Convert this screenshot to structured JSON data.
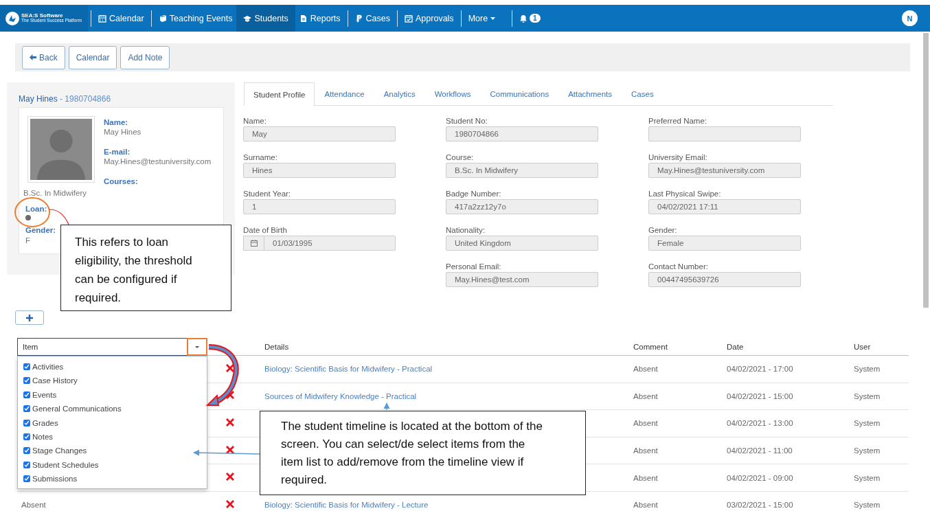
{
  "nav": {
    "logo": {
      "title": "SEA:S Software",
      "subtitle": "The Student Success Platform"
    },
    "items": [
      {
        "label": "Calendar",
        "kind": "link",
        "selected": false
      },
      {
        "label": "Teaching Events",
        "kind": "link",
        "selected": false
      },
      {
        "label": "Students",
        "kind": "link",
        "selected": true
      },
      {
        "label": "Reports",
        "kind": "link",
        "selected": false
      },
      {
        "label": "Cases",
        "kind": "link",
        "selected": false
      },
      {
        "label": "Approvals",
        "kind": "link",
        "selected": false
      },
      {
        "label": "More",
        "kind": "menu",
        "selected": false
      }
    ],
    "notifications": "1",
    "avatar": "N"
  },
  "toolbar": {
    "buttons": [
      {
        "label": "Back"
      },
      {
        "label": "Calendar"
      },
      {
        "label": "Add Note"
      }
    ]
  },
  "profile": {
    "name": "May Hines",
    "number": "- 1980704866",
    "fields": [
      {
        "label": "Name:",
        "value": "May Hines"
      },
      {
        "label": "E-mail:",
        "value": "May.Hines@testuniversity.com"
      },
      {
        "label": "Courses:"
      }
    ],
    "course": "B.Sc. In Midwifery",
    "loan": {
      "label": "Loan:",
      "color": "#6b6b6b"
    },
    "gender": {
      "label": "Gender:",
      "value": "F"
    }
  },
  "tabs": [
    {
      "label": "Student Profile",
      "selected": true
    },
    {
      "label": "Attendance",
      "selected": false
    },
    {
      "label": "Analytics",
      "selected": false
    },
    {
      "label": "Workflows",
      "selected": false
    },
    {
      "label": "Communications",
      "selected": false
    },
    {
      "label": "Attachments",
      "selected": false
    },
    {
      "label": "Cases",
      "selected": false
    }
  ],
  "form": {
    "columns": [
      [
        {
          "label": "Name:",
          "value": "May",
          "kind": "text"
        },
        {
          "label": "Surname:",
          "value": "Hines",
          "kind": "text"
        },
        {
          "label": "Student Year:",
          "value": "1",
          "kind": "text"
        },
        {
          "label": "Date of Birth",
          "value": "01/03/1995",
          "kind": "date"
        }
      ],
      [
        {
          "label": "Student No:",
          "value": "1980704866",
          "kind": "text"
        },
        {
          "label": "Course:",
          "value": "B.Sc. In Midwifery",
          "kind": "text"
        },
        {
          "label": "Badge Number:",
          "value": "417a2zz12y7o",
          "kind": "text"
        },
        {
          "label": "Nationality:",
          "value": "United Kingdom",
          "kind": "text"
        },
        {
          "label": "Personal Email:",
          "value": "May.Hines@test.com",
          "kind": "text"
        }
      ],
      [
        {
          "label": "Preferred Name:",
          "kind": "text"
        },
        {
          "label": "University Email:",
          "value": "May.Hines@testuniversity.com",
          "kind": "text"
        },
        {
          "label": "Last Physical Swipe:",
          "value": "04/02/2021 17:11",
          "kind": "text"
        },
        {
          "label": "Gender:",
          "value": "Female",
          "kind": "text"
        },
        {
          "label": "Contact Number:",
          "value": "00447495639726",
          "kind": "text"
        }
      ]
    ]
  },
  "timeline": {
    "filter": {
      "label": "Item",
      "options": [
        {
          "label": "Activities",
          "checked": true
        },
        {
          "label": "Case History",
          "checked": true
        },
        {
          "label": "Events",
          "checked": true
        },
        {
          "label": "General Communications",
          "checked": true
        },
        {
          "label": "Grades",
          "checked": true
        },
        {
          "label": "Notes",
          "checked": true
        },
        {
          "label": "Stage Changes",
          "checked": true
        },
        {
          "label": "Student Schedules",
          "checked": true
        },
        {
          "label": "Submissions",
          "checked": true
        }
      ]
    },
    "columns": [
      "Details",
      "Comment",
      "Date",
      "User"
    ],
    "rows": [
      {
        "details": "Biology: Scientific Basis for Midwifery - Practical",
        "comment": "Absent",
        "date": "04/02/2021 - 17:00",
        "user": "System"
      },
      {
        "details": "Sources of Midwifery Knowledge - Practical",
        "comment": "Absent",
        "date": "04/02/2021 - 15:00",
        "user": "System"
      },
      {
        "comment": "Absent",
        "date": "04/02/2021 - 13:00",
        "user": "System"
      },
      {
        "comment": "Absent",
        "date": "04/02/2021 - 11:00",
        "user": "System"
      },
      {
        "comment": "Absent",
        "date": "04/02/2021 - 09:00",
        "user": "System"
      },
      {
        "item": "Absent",
        "details": "Biology: Scientific Basis for Midwifery - Lecture",
        "comment": "Absent",
        "date": "03/02/2021 - 15:00",
        "user": "System"
      }
    ]
  },
  "annotations": [
    {
      "text": "This refers to loan eligibility, the threshold can be configured if required."
    },
    {
      "text": "The student timeline is located at the bottom of the screen. You can select/de select items from the item list to add/remove from the timeline view if required."
    }
  ]
}
